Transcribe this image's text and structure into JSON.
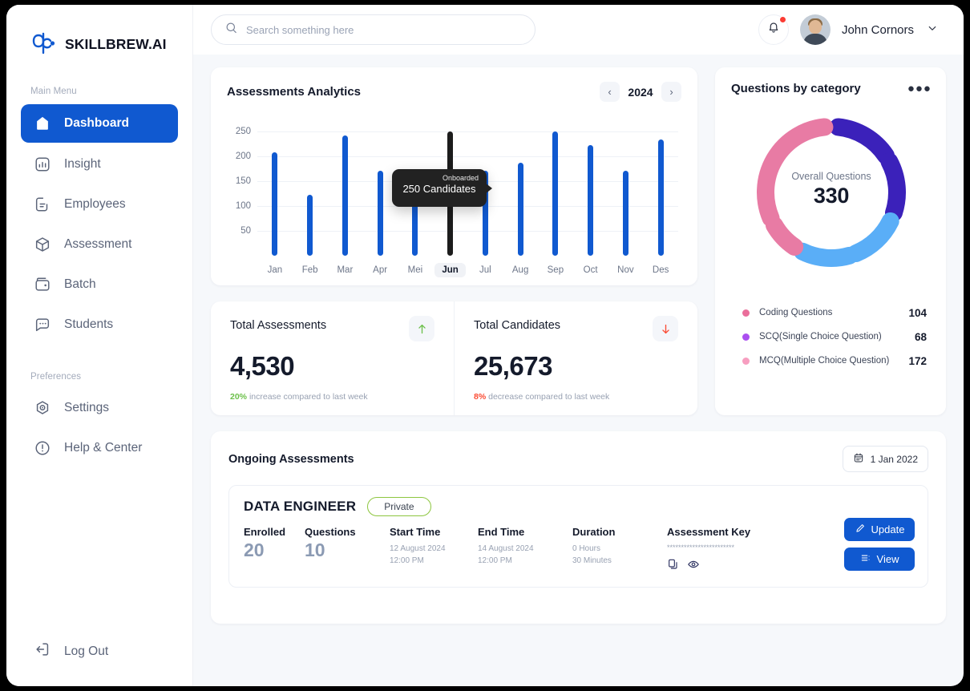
{
  "brand": {
    "name": "SKILLBREW.AI",
    "logo_icon": "skillbrew-logo-icon"
  },
  "sidebar": {
    "main_menu_label": "Main Menu",
    "preferences_label": "Preferences",
    "items": [
      {
        "label": "Dashboard",
        "icon": "home-icon",
        "active": true
      },
      {
        "label": "Insight",
        "icon": "chart-icon",
        "active": false
      },
      {
        "label": "Employees",
        "icon": "document-icon",
        "active": false
      },
      {
        "label": "Assessment",
        "icon": "box-icon",
        "active": false
      },
      {
        "label": "Batch",
        "icon": "wallet-icon",
        "active": false
      },
      {
        "label": "Students",
        "icon": "chat-icon",
        "active": false
      }
    ],
    "preferences": [
      {
        "label": "Settings",
        "icon": "gear-icon"
      },
      {
        "label": "Help & Center",
        "icon": "info-icon"
      }
    ],
    "logout": {
      "label": "Log Out",
      "icon": "logout-icon"
    }
  },
  "topbar": {
    "search": {
      "placeholder": "Search something here",
      "value": "",
      "icon": "search-icon"
    },
    "notification_icon": "bell-icon",
    "has_notification": true,
    "user": {
      "name": "John Cornors",
      "avatar": "user-avatar",
      "chevron": "chevron-down-icon"
    }
  },
  "analytics": {
    "title": "Assessments Analytics",
    "year": "2024",
    "prev_icon": "chevron-left-icon",
    "next_icon": "chevron-right-icon",
    "tooltip": {
      "label": "Onboarded",
      "value": "250 Candidates"
    }
  },
  "chart_data": [
    {
      "type": "bar",
      "title": "Assessments Analytics",
      "xlabel": "",
      "ylabel": "",
      "categories": [
        "Jan",
        "Feb",
        "Mar",
        "Apr",
        "Mei",
        "Jun",
        "Jul",
        "Aug",
        "Sep",
        "Oct",
        "Nov",
        "Des"
      ],
      "values": [
        208,
        123,
        243,
        172,
        142,
        250,
        172,
        187,
        251,
        223,
        172,
        235
      ],
      "selected_index": 5,
      "selected_category": "Jun",
      "yticks": [
        50,
        100,
        150,
        200,
        250
      ],
      "ylim": [
        0,
        275
      ],
      "grid": true,
      "bar_color": "#1059d0",
      "selected_bar_color": "#1c1c1c",
      "annotation": {
        "category": "Jun",
        "label": "Onboarded",
        "value": "250 Candidates"
      }
    },
    {
      "type": "pie",
      "title": "Questions by category",
      "center_label": "Overall Questions",
      "center_value": "330",
      "labels": [
        "Coding Questions",
        "SCQ(Single Choice Question)",
        "MCQ(Multiple Choice Question)"
      ],
      "values": [
        104,
        68,
        172
      ],
      "colors": [
        "#ea6e9b",
        "#ab4ff0",
        "#f79ec0"
      ],
      "legend_position": "bottom",
      "segments": [
        {
          "name": "SCQ",
          "color": "#3b21ba",
          "start_deg": 6,
          "end_deg": 56
        },
        {
          "name": "SCQ",
          "color": "#3b21ba",
          "start_deg": 62,
          "end_deg": 108
        },
        {
          "name": "MCQ",
          "color": "#5aaef7",
          "start_deg": 116,
          "end_deg": 158
        },
        {
          "name": "MCQ",
          "color": "#5aaef7",
          "start_deg": 164,
          "end_deg": 206
        },
        {
          "name": "Coding",
          "color": "#e87ba4",
          "start_deg": 214,
          "end_deg": 240
        },
        {
          "name": "Coding",
          "color": "#e87ba4",
          "start_deg": 247,
          "end_deg": 354
        }
      ]
    }
  ],
  "stats": [
    {
      "title": "Total Assessments",
      "value": "4,530",
      "arrow": "arrow-up-icon",
      "arrow_color": "#6cc04a",
      "delta": "20%",
      "delta_text": "increase compared to last week",
      "direction": "up"
    },
    {
      "title": "Total Candidates",
      "value": "25,673",
      "arrow": "arrow-down-icon",
      "arrow_color": "#fb4b33",
      "delta": "8%",
      "delta_text": "decrease compared to last week",
      "direction": "down"
    }
  ],
  "questions_card": {
    "title": "Questions by category",
    "more_icon": "more-options-icon",
    "more_label": "●●●",
    "center_label": "Overall Questions",
    "center_value": "330",
    "legend": [
      {
        "label": "Coding Questions",
        "value": "104",
        "color": "#ea6e9b"
      },
      {
        "label": "SCQ(Single Choice Question)",
        "value": "68",
        "color": "#ab4ff0"
      },
      {
        "label": "MCQ(Multiple Choice Question)",
        "value": "172",
        "color": "#f79ec0"
      }
    ]
  },
  "ongoing": {
    "title": "Ongoing Assessments",
    "date_filter": {
      "label": "1 Jan 2022",
      "icon": "calendar-icon"
    },
    "assessment": {
      "name": "DATA ENGINEER",
      "visibility": "Private",
      "columns": [
        {
          "header": "Enrolled",
          "value": "20"
        },
        {
          "header": "Questions",
          "value": "10"
        }
      ],
      "start_time": {
        "header": "Start Time",
        "date": "12 August 2024",
        "time": "12:00 PM"
      },
      "end_time": {
        "header": "End Time",
        "date": "14 August 2024",
        "time": "12:00 PM"
      },
      "duration": {
        "header": "Duration",
        "hours": "0 Hours",
        "minutes": "30 Minutes"
      },
      "assessment_key": {
        "header": "Assessment Key",
        "masked": "************************",
        "copy_icon": "copy-icon",
        "view_icon": "eye-icon"
      },
      "buttons": [
        {
          "label": "Update",
          "icon": "pencil-icon"
        },
        {
          "label": "View",
          "icon": "list-icon"
        }
      ]
    }
  }
}
